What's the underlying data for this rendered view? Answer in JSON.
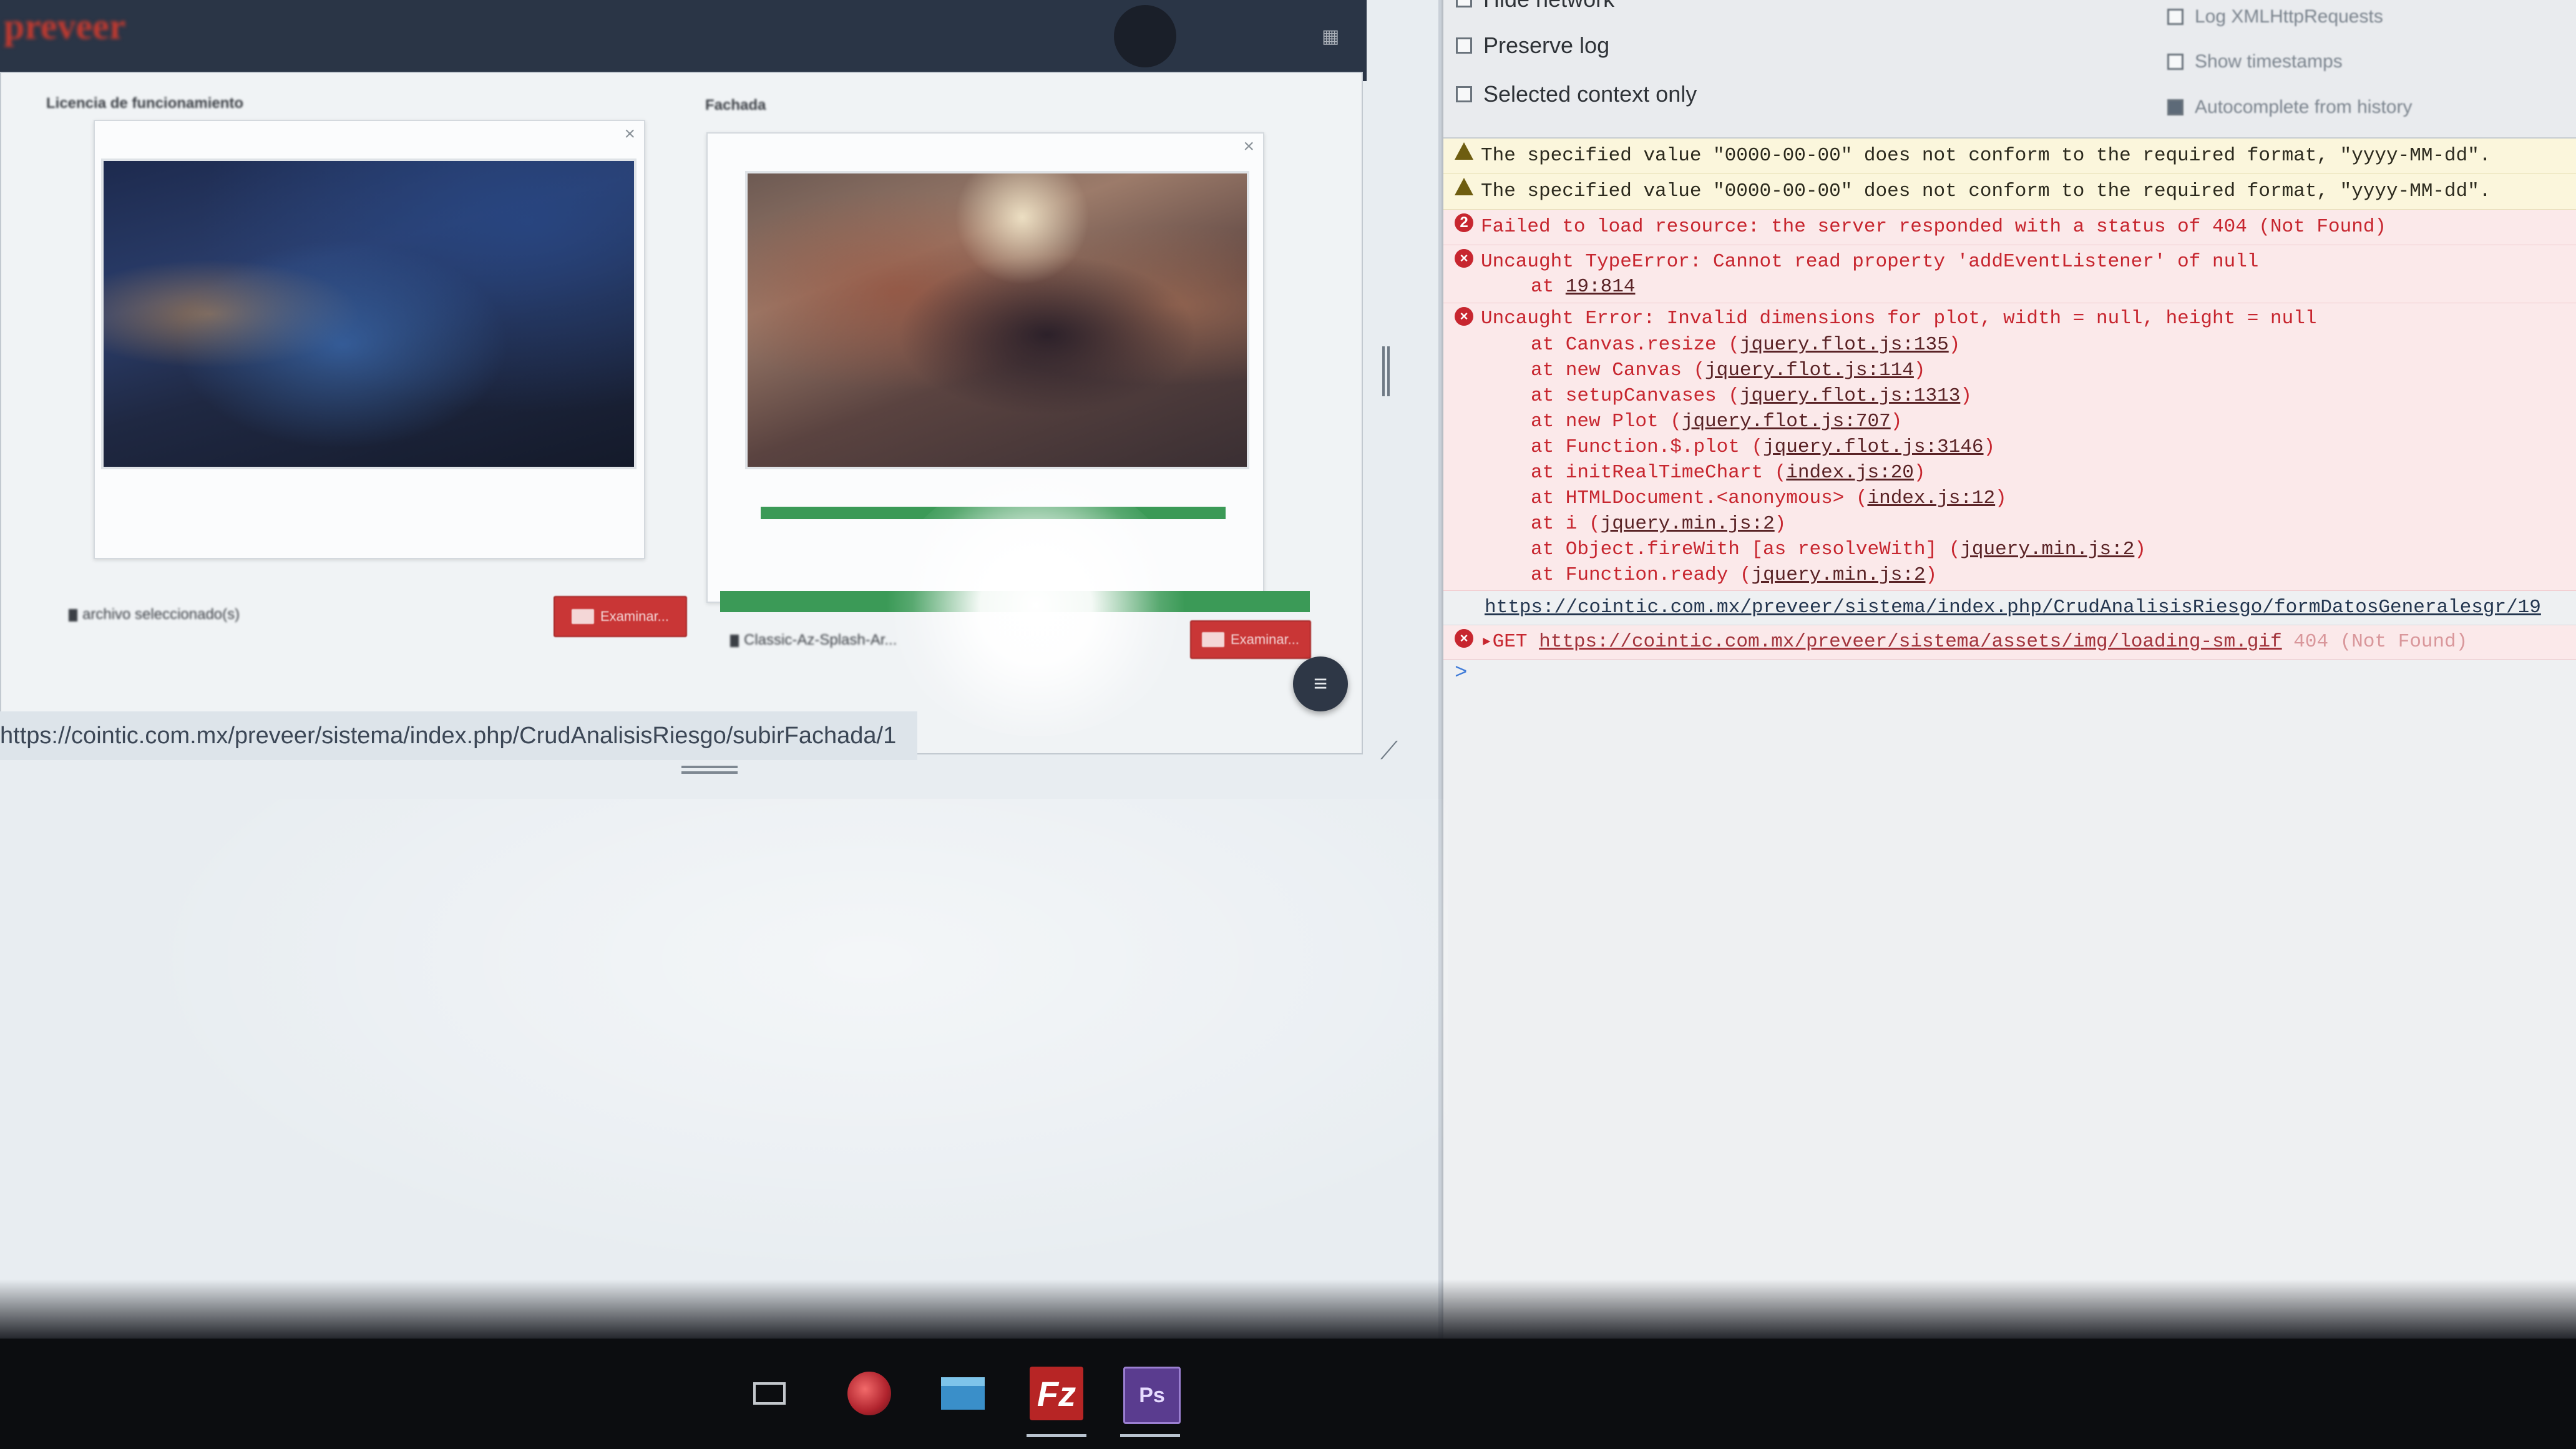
{
  "web_page": {
    "brand": "preveer",
    "user_name": "",
    "sections": {
      "licencia_title": "Licencia de funcionamiento",
      "fachada_title": "Fachada"
    },
    "licencia": {
      "file_info": "archivo seleccionado(s)",
      "browse_label": "Examinar..."
    },
    "fachada": {
      "file_info": "Classic-Az-Splash-Ar...",
      "browse_label": "Examinar...",
      "card_progress_fraction": 1.0,
      "upload_progress_fraction": 1.0
    },
    "floating_menu_icon": "≡",
    "status_url": "https://cointic.com.mx/preveer/sistema/index.php/CrudAnalisisRiesgo/subirFachada/1"
  },
  "devtools": {
    "settings": {
      "hide_network": "Hide network",
      "preserve_log": "Preserve log",
      "selected_context_only": "Selected context only",
      "log_xhr": "Log XMLHttpRequests",
      "show_timestamps": "Show timestamps",
      "autocomplete": "Autocomplete from history"
    },
    "logs": {
      "warn1": "The specified value \"0000-00-00\" does not conform to the required format, \"yyyy-MM-dd\".",
      "warn2": "The specified value \"0000-00-00\" does not conform to the required format, \"yyyy-MM-dd\".",
      "resource_count": "2",
      "resource_text": "Failed to load resource: the server responded with a status of 404 (Not Found)",
      "type_error": "Uncaught TypeError: Cannot read property 'addEventListener' of null",
      "type_error_at": "at ",
      "type_error_loc": "19:814",
      "plot_error": "Uncaught Error: Invalid dimensions for plot, width = null, height = null",
      "stack": [
        {
          "at": "at Canvas.resize (",
          "loc": "jquery.flot.js:135",
          "end": ")"
        },
        {
          "at": "at new Canvas (",
          "loc": "jquery.flot.js:114",
          "end": ")"
        },
        {
          "at": "at setupCanvases (",
          "loc": "jquery.flot.js:1313",
          "end": ")"
        },
        {
          "at": "at new Plot (",
          "loc": "jquery.flot.js:707",
          "end": ")"
        },
        {
          "at": "at Function.$.plot (",
          "loc": "jquery.flot.js:3146",
          "end": ")"
        },
        {
          "at": "at initRealTimeChart (",
          "loc": "index.js:20",
          "end": ")"
        },
        {
          "at": "at HTMLDocument.<anonymous> (",
          "loc": "index.js:12",
          "end": ")"
        },
        {
          "at": "at i (",
          "loc": "jquery.min.js:2",
          "end": ")"
        },
        {
          "at": "at Object.fireWith [as resolveWith] (",
          "loc": "jquery.min.js:2",
          "end": ")"
        },
        {
          "at": "at Function.ready (",
          "loc": "jquery.min.js:2",
          "end": ")"
        }
      ],
      "form_url": "https://cointic.com.mx/preveer/sistema/index.php/CrudAnalisisRiesgo/formDatosGeneralesgr/19",
      "get_method": "GET",
      "get_url": "https://cointic.com.mx/preveer/sistema/assets/img/loading-sm.gif",
      "get_status": "404 (Not Found)",
      "prompt": ">"
    }
  },
  "taskbar": {
    "apps": [
      "task-view",
      "browser",
      "file-explorer",
      "filezilla",
      "photoshop"
    ],
    "filezilla_label": "Fz",
    "photoshop_label": "Ps"
  }
}
